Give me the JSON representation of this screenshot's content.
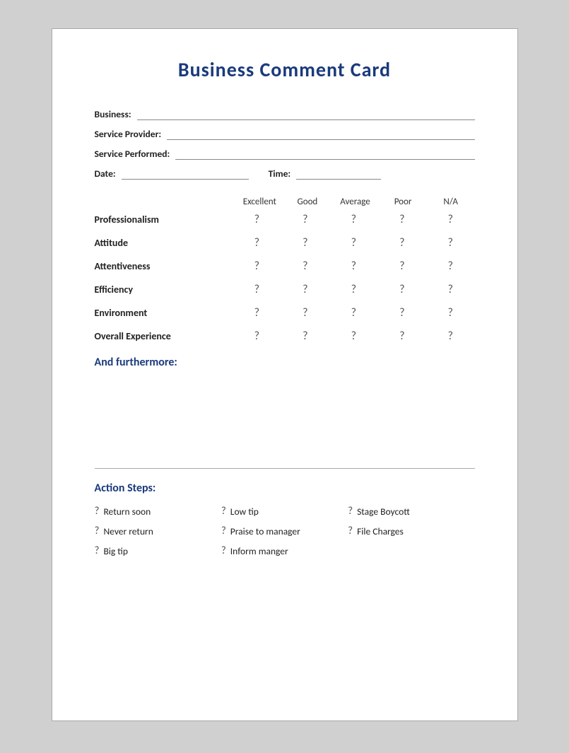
{
  "title": "Business Comment Card",
  "fields": {
    "business_label": "Business:",
    "service_provider_label": "Service Provider:",
    "service_performed_label": "Service Performed:",
    "date_label": "Date:",
    "time_label": "Time:"
  },
  "rating_table": {
    "headers": [
      "Excellent",
      "Good",
      "Average",
      "Poor",
      "N/A"
    ],
    "rows": [
      {
        "label": "Professionalism"
      },
      {
        "label": "Attitude"
      },
      {
        "label": "Attentiveness"
      },
      {
        "label": "Efficiency"
      },
      {
        "label": "Environment"
      },
      {
        "label": "Overall Experience"
      }
    ],
    "radio_symbol": "?"
  },
  "furthermore": {
    "title": "And furthermore:"
  },
  "action_steps": {
    "title": "Action Steps:",
    "items": [
      {
        "text": "Return soon",
        "col": 0
      },
      {
        "text": "Low tip",
        "col": 1
      },
      {
        "text": "Stage Boycott",
        "col": 2
      },
      {
        "text": "Never return",
        "col": 0
      },
      {
        "text": "Praise to manager",
        "col": 1
      },
      {
        "text": "File Charges",
        "col": 2
      },
      {
        "text": "Big tip",
        "col": 0
      },
      {
        "text": "Inform manger",
        "col": 1
      }
    ],
    "checkbox_symbol": "?"
  }
}
